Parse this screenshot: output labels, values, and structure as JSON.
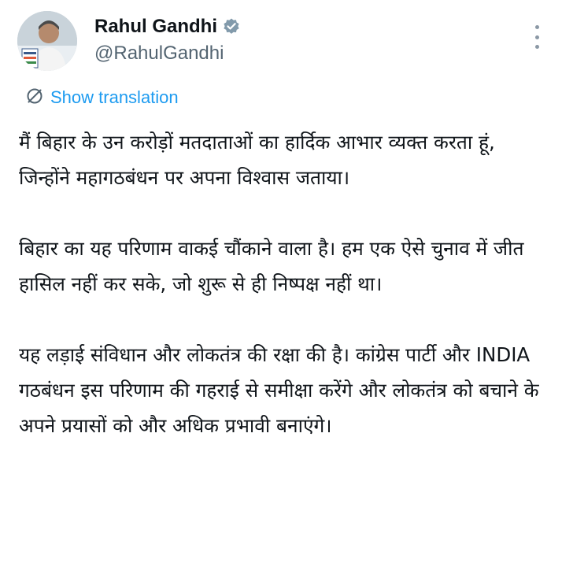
{
  "author": {
    "display_name": "Rahul Gandhi",
    "handle": "@RahulGandhi",
    "verified": true,
    "avatar_icon": "profile-photo"
  },
  "actions": {
    "more_icon": "more-vertical-icon",
    "show_translation_label": "Show translation",
    "translate_icon": "translate-icon"
  },
  "colors": {
    "link": "#1d9bf0",
    "muted": "#536471",
    "text": "#0f1419",
    "verified_badge": "#829aab"
  },
  "tweet": {
    "paragraphs": [
      "मैं बिहार के उन करोड़ों मतदाताओं का हार्दिक आभार व्यक्त करता हूं, जिन्होंने महागठबंधन पर अपना विश्वास जताया।",
      "बिहार का यह परिणाम वाकई चौंकाने वाला है। हम एक ऐसे चुनाव में जीत हासिल नहीं कर सके, जो शुरू से ही निष्पक्ष नहीं था।",
      "यह लड़ाई संविधान और लोकतंत्र की रक्षा की है। कांग्रेस पार्टी और INDIA गठबंधन इस परिणाम की गहराई से समीक्षा करेंगे और लोकतंत्र को बचाने के अपने प्रयासों को और अधिक प्रभावी बनाएंगे।"
    ]
  }
}
